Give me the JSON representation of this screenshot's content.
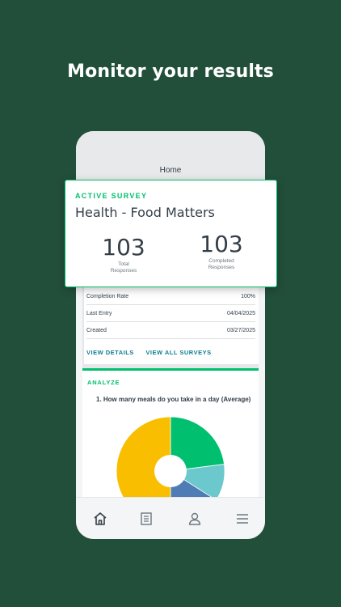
{
  "headline": "Monitor your results",
  "screen": {
    "title": "Home"
  },
  "active_survey": {
    "label": "ACTIVE SURVEY",
    "title": "Health - Food Matters",
    "stats": [
      {
        "value": "103",
        "label_line1": "Total",
        "label_line2": "Responses"
      },
      {
        "value": "103",
        "label_line1": "Completed",
        "label_line2": "Responses"
      }
    ]
  },
  "details": [
    {
      "key": "Completion Rate",
      "value": "100%"
    },
    {
      "key": "Last Entry",
      "value": "04/04/2025"
    },
    {
      "key": "Created",
      "value": "03/27/2025"
    }
  ],
  "links": {
    "view_details": "VIEW DETAILS",
    "view_all": "VIEW ALL SURVEYS"
  },
  "analyze": {
    "label": "ANALYZE",
    "question": "1.  How many meals do you take in a day (Average)"
  },
  "chart_data": {
    "type": "pie",
    "values": [
      50,
      23,
      11,
      16
    ],
    "colors": [
      "#f9be00",
      "#00bf6f",
      "#6bc8cd",
      "#507cb6"
    ]
  },
  "tabbar": {
    "items": [
      "home-icon",
      "list-icon",
      "person-icon",
      "menu-icon"
    ]
  },
  "colors": {
    "background": "#224f3a",
    "accent": "#00bf6f",
    "link": "#0d7e91"
  }
}
